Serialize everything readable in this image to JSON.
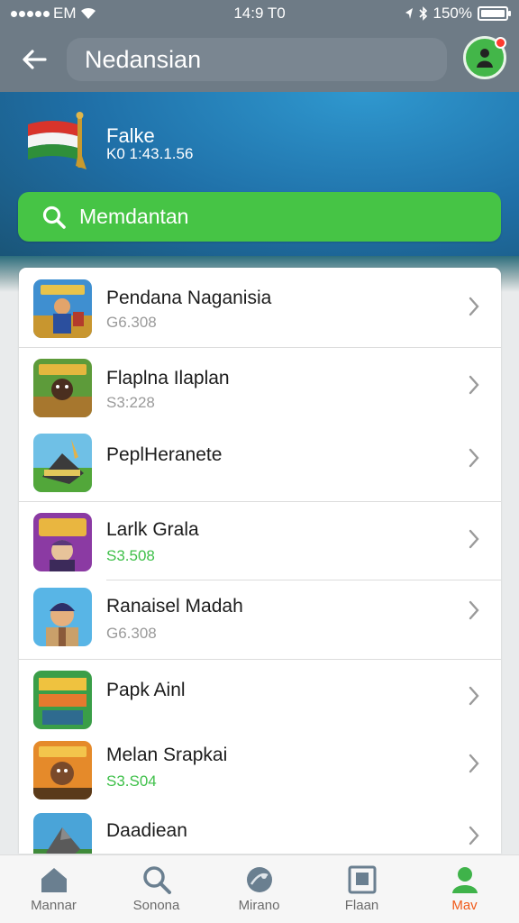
{
  "status_bar": {
    "carrier": "EM",
    "time": "14:9 T0",
    "battery": "150%",
    "battery_level": 1.0
  },
  "header": {
    "title": "Nedansian",
    "profile_icon": "user-icon",
    "notification_color": "#ff3b30"
  },
  "banner": {
    "name": "Falke",
    "subtitle": "K0 1:43.1.56",
    "search_label": "Memdantan",
    "search_color": "#46c445"
  },
  "games": [
    {
      "name": "Pendana Naganisia",
      "price": "G6.308",
      "price_color": "gray",
      "icon": "game-thumb-warrior"
    },
    {
      "name": "Flaplna Ilaplan",
      "price": "S3:228",
      "price_color": "gray",
      "icon": "game-thumb-bear"
    },
    {
      "name": "PeplHeranete",
      "price": "",
      "price_color": "gray",
      "icon": "game-thumb-tank"
    },
    {
      "name": "Larlk Grala",
      "price": "S3.508",
      "price_color": "green",
      "icon": "game-thumb-wizard"
    },
    {
      "name": "Ranaisel Madah",
      "price": "G6.308",
      "price_color": "gray",
      "icon": "game-thumb-hero"
    },
    {
      "name": "Papk Ainl",
      "price": "",
      "price_color": "gray",
      "icon": "game-thumb-poster"
    },
    {
      "name": "Melan Srapkai",
      "price": "S3.S04",
      "price_color": "green",
      "icon": "game-thumb-dwarf"
    },
    {
      "name": "Daadiean",
      "price": "",
      "price_color": "gray",
      "icon": "game-thumb-rock"
    }
  ],
  "nav": [
    {
      "label": "Mannar",
      "icon": "home-icon",
      "active": false
    },
    {
      "label": "Sonona",
      "icon": "search-icon",
      "active": false
    },
    {
      "label": "Mirano",
      "icon": "globe-icon",
      "active": false
    },
    {
      "label": "Flaan",
      "icon": "frame-icon",
      "active": false
    },
    {
      "label": "Mav",
      "icon": "user-icon",
      "active": true
    }
  ],
  "colors": {
    "accent_green": "#3fc04a",
    "active_nav": "#f05a1a",
    "header_bg": "#6e7b86"
  }
}
